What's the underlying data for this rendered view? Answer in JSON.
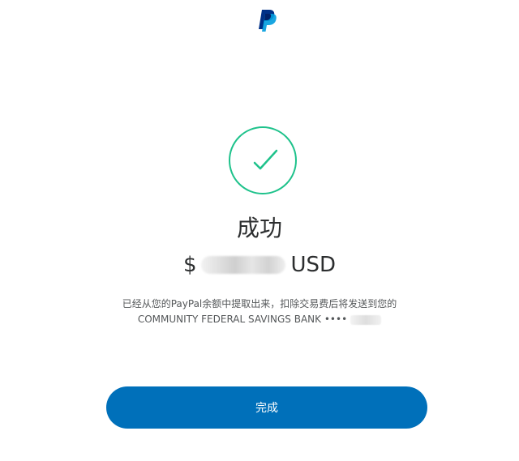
{
  "brand": {
    "logo_icon": "paypal-logo-icon",
    "colors": {
      "logo_dark": "#003087",
      "logo_light": "#009cde",
      "success_green": "#1ec28b",
      "button_blue": "#0070ba"
    }
  },
  "status": {
    "icon": "success-check-icon",
    "title": "成功"
  },
  "amount": {
    "currency_symbol": "$",
    "currency_code": "USD"
  },
  "description": {
    "line1": "已经从您的PayPal余额中提取出来，扣除交易费后将发送到您的",
    "line2_prefix": "COMMUNITY FEDERAL SAVINGS BANK ••••"
  },
  "actions": {
    "done_label": "完成"
  }
}
